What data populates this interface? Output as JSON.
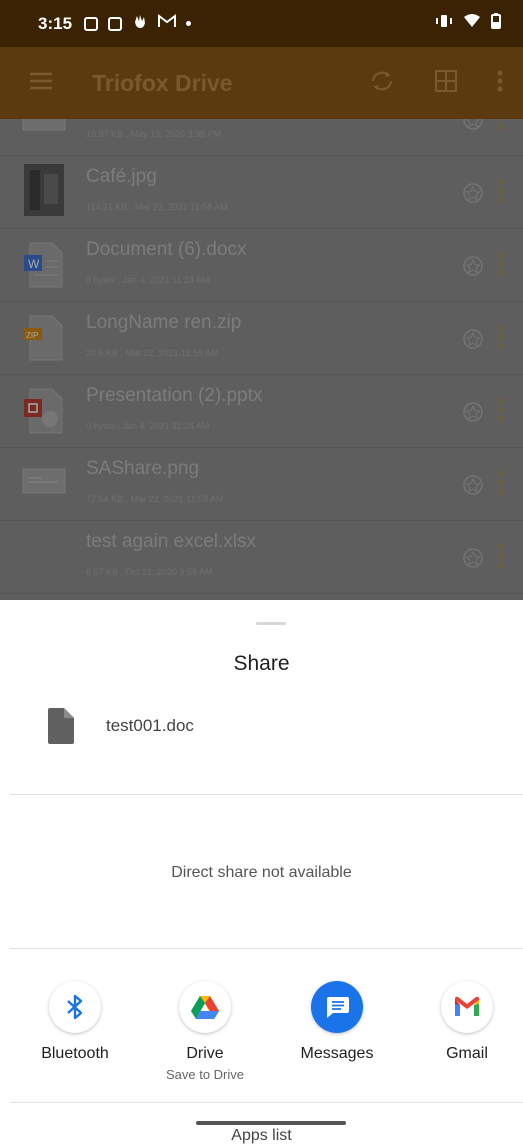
{
  "status_bar": {
    "time": "3:15",
    "left_icons": [
      "notification-icon",
      "notification-icon",
      "hand-icon",
      "gmail-icon",
      "dot-icon"
    ],
    "right_icons": [
      "vibrate-icon",
      "wifi-icon",
      "battery-icon"
    ]
  },
  "app_bar": {
    "title": "Triofox Drive",
    "icons": [
      "menu-icon",
      "sync-icon",
      "grid-view-icon",
      "more-vert-icon"
    ],
    "background": "#5c3a10"
  },
  "files": [
    {
      "name": "",
      "meta": "10.97 KB , May 13, 2020 3:38 PM",
      "icon": "image-thumbnail-icon"
    },
    {
      "name": "Café.jpg",
      "meta": "114.21 KB , Mar 22, 2021 11:58 AM",
      "icon": "photo-thumbnail-icon"
    },
    {
      "name": "Document (6).docx",
      "meta": "0 bytes , Jan 4, 2021 11:24 AM",
      "icon": "word-file-icon"
    },
    {
      "name": "LongName ren.zip",
      "meta": "20.6 KB , Mar 22, 2021 11:58 AM",
      "icon": "zip-file-icon"
    },
    {
      "name": "Presentation (2).pptx",
      "meta": "0 bytes , Jan 4, 2021 11:24 AM",
      "icon": "powerpoint-file-icon"
    },
    {
      "name": "SAShare.png",
      "meta": "72.54 KB , Mar 22, 2021 11:58 AM",
      "icon": "image-thumbnail-icon"
    },
    {
      "name": "test again excel.xlsx",
      "meta": "6.07 KB , Oct 21, 2020 9:59 AM",
      "icon": ""
    }
  ],
  "share_sheet": {
    "title": "Share",
    "file_name": "test001.doc",
    "direct_share_text": "Direct share not available",
    "apps": [
      {
        "label": "Bluetooth",
        "sublabel": "",
        "icon": "bluetooth-icon"
      },
      {
        "label": "Drive",
        "sublabel": "Save to Drive",
        "icon": "google-drive-icon"
      },
      {
        "label": "Messages",
        "sublabel": "",
        "icon": "messages-icon"
      },
      {
        "label": "Gmail",
        "sublabel": "",
        "icon": "gmail-icon"
      }
    ],
    "apps_list_label": "Apps list"
  },
  "colors": {
    "status_bar": "#3a2203",
    "app_bar": "#5c3a10",
    "scrim_list": "#5e5e5e",
    "messages_blue": "#1a73e8",
    "bluetooth_blue": "#1a73e8"
  }
}
